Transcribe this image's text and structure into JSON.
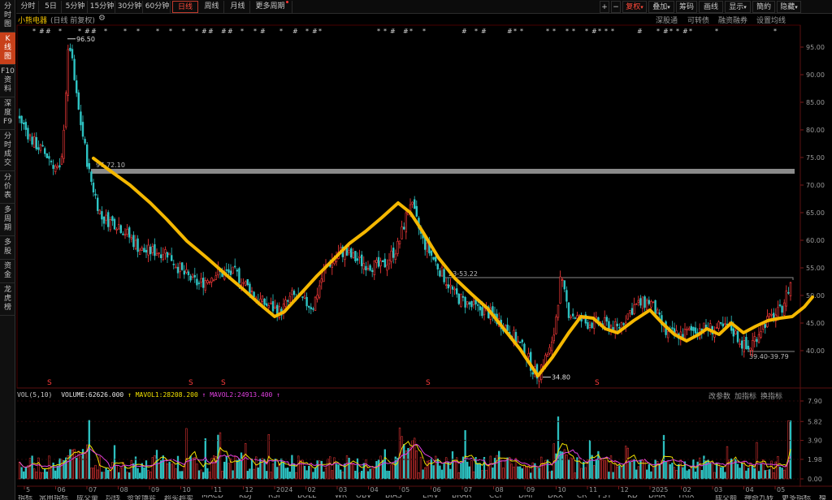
{
  "sidebar": {
    "items": [
      {
        "label": "分\n时\n图",
        "active": false
      },
      {
        "label": "K\n线\n图",
        "active": true
      },
      {
        "label": "F10\n资\n料",
        "active": false
      },
      {
        "label": "深\n度\nF9",
        "active": false
      },
      {
        "label": "分\n时\n成\n交",
        "active": false
      },
      {
        "label": "分\n价\n表",
        "active": false
      },
      {
        "label": "多\n周\n期",
        "active": false
      },
      {
        "label": "多\n股",
        "active": false
      },
      {
        "label": "资\n金",
        "active": false
      },
      {
        "label": "龙\n虎\n榜",
        "active": false
      }
    ]
  },
  "toolbar": {
    "periods": [
      "分时",
      "5日",
      "5分钟",
      "15分钟",
      "30分钟",
      "60分钟",
      "日线",
      "周线",
      "月线",
      "更多周期"
    ],
    "active_period": "日线",
    "right_buttons": [
      "+",
      "−",
      "复权",
      "叠加",
      "筹码",
      "画线",
      "显示",
      "簡約",
      "隐藏"
    ]
  },
  "info": {
    "stock_name": "小熊电器",
    "mode": "(日线 前复权)",
    "links": [
      "深股通",
      "可转债",
      "融资融券",
      "设置均线"
    ]
  },
  "price_axis": {
    "ticks": [
      "95.00",
      "90.00",
      "85.00",
      "80.00",
      "75.00",
      "70.00",
      "65.00",
      "60.00",
      "55.00",
      "50.00",
      "45.00",
      "40.00"
    ]
  },
  "annotations": {
    "high_label": "96.50",
    "low_label": "34.80",
    "band_label": "97-72.10",
    "box_label": "23-53.22",
    "range_label": "39.40-39.79"
  },
  "volume_header": {
    "vol_label": "VOL(5,10)",
    "volume": "VOLUME:62626.000",
    "mavol1": "MAVOL1:28208.200",
    "mavol2": "MAVOL2:24913.400",
    "links": [
      "改参数",
      "加指标",
      "换指标"
    ],
    "colors": {
      "volume": "#e8e8e8",
      "mavol1": "#f0e000",
      "mavol2": "#e040e0"
    }
  },
  "volume_axis": {
    "ticks": [
      "7.90",
      "5.82",
      "3.90",
      "1.98",
      "0.00"
    ]
  },
  "time_axis": {
    "labels": [
      "5",
      "06",
      "07",
      "08",
      "09",
      "10",
      "11",
      "12",
      "2024",
      "02",
      "03",
      "04",
      "05",
      "06",
      "07",
      "08",
      "09",
      "10",
      "11",
      "12",
      "2025",
      "02",
      "03",
      "04",
      "05"
    ]
  },
  "bottom_tabs": [
    "指标",
    "常用指标",
    "成交量",
    "均线",
    "资金博弈",
    "超买超卖",
    "MACD",
    "KDJ",
    "RSI",
    "BOLL",
    "WR",
    "OBV",
    "BIAS",
    "EMV",
    "BRAR",
    "CCI",
    "DMI",
    "DKX",
    "CR",
    "PSY",
    "KD",
    "DMA",
    "TRIX",
    "成交额",
    "神奇九转",
    "更多指标",
    "模板"
  ],
  "colors": {
    "up": "#ff3b3b",
    "down": "#2ec4c4",
    "trend": "#f5b800",
    "band": "#8a8a8a",
    "accent": "#c8401a"
  }
}
